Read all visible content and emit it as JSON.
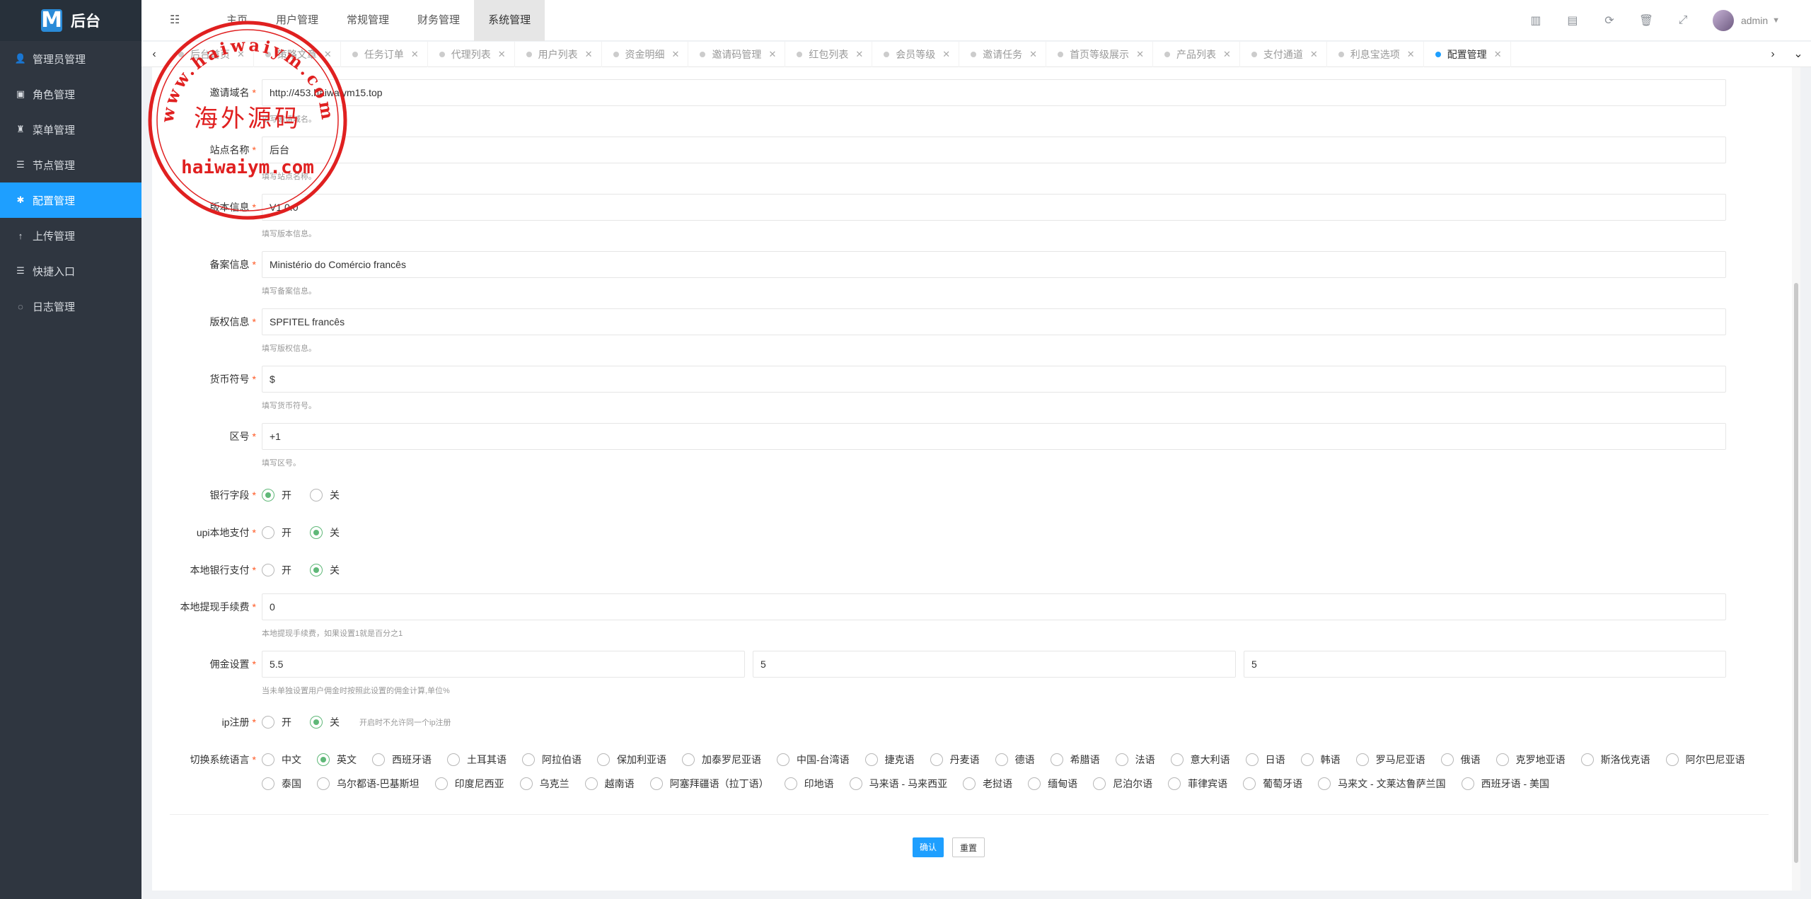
{
  "app": {
    "logo_letter": "M",
    "title": "后台"
  },
  "sidebar": {
    "items": [
      {
        "label": "管理员管理",
        "icon": "user-icon",
        "glyph": "👤"
      },
      {
        "label": "角色管理",
        "icon": "id-card-icon",
        "glyph": "▣"
      },
      {
        "label": "菜单管理",
        "icon": "bell-icon",
        "glyph": "♜"
      },
      {
        "label": "节点管理",
        "icon": "list-icon",
        "glyph": "☰"
      },
      {
        "label": "配置管理",
        "icon": "gear-icon",
        "glyph": "✱"
      },
      {
        "label": "上传管理",
        "icon": "upload-icon",
        "glyph": "↑"
      },
      {
        "label": "快捷入口",
        "icon": "list-icon",
        "glyph": "☰"
      },
      {
        "label": "日志管理",
        "icon": "log-icon",
        "glyph": "◌"
      }
    ],
    "active_index": 4
  },
  "topnav": {
    "items": [
      "主页",
      "用户管理",
      "常规管理",
      "财务管理",
      "系统管理"
    ],
    "active_index": 4
  },
  "topbar_icons": [
    "chart-icon",
    "card-icon",
    "refresh-icon",
    "trash-icon",
    "fullscreen-icon"
  ],
  "user": {
    "name": "admin"
  },
  "tabs": {
    "items": [
      "后台首页",
      "策略文章",
      "任务订单",
      "代理列表",
      "用户列表",
      "资金明细",
      "邀请码管理",
      "红包列表",
      "会员等级",
      "邀请任务",
      "首页等级展示",
      "产品列表",
      "支付通道",
      "利息宝选项",
      "配置管理"
    ],
    "active_index": 14
  },
  "form": {
    "invite_domain": {
      "label": "邀请域名",
      "value": "http://453.haiwaiym15.top",
      "help": "填写邀请域名。"
    },
    "site_name": {
      "label": "站点名称",
      "value": "后台",
      "help": "填写站点名称。"
    },
    "version": {
      "label": "版本信息",
      "value": "V1.0.0",
      "help": "填写版本信息。"
    },
    "record": {
      "label": "备案信息",
      "value": "Ministério do Comércio francês",
      "help": "填写备案信息。"
    },
    "copyright": {
      "label": "版权信息",
      "value": "SPFITEL francês",
      "help": "填写版权信息。"
    },
    "currency": {
      "label": "货币符号",
      "value": "$",
      "help": "填写货币符号。"
    },
    "area_code": {
      "label": "区号",
      "value": "+1",
      "help": "填写区号。"
    },
    "bank_field": {
      "label": "银行字段",
      "on": "开",
      "off": "关",
      "selected": "on"
    },
    "upi_pay": {
      "label": "upi本地支付",
      "on": "开",
      "off": "关",
      "selected": "off"
    },
    "local_bank_pay": {
      "label": "本地银行支付",
      "on": "开",
      "off": "关",
      "selected": "off"
    },
    "withdraw_fee": {
      "label": "本地提现手续费",
      "value": "0",
      "help": "本地提现手续费，如果设置1就是百分之1"
    },
    "commission": {
      "label": "佣金设置",
      "values": [
        "5.5",
        "5",
        "5"
      ],
      "help": "当未单独设置用户佣金时按照此设置的佣金计算,单位%"
    },
    "ip_register": {
      "label": "ip注册",
      "on": "开",
      "off": "关",
      "selected": "off",
      "help": "开启时不允许同一个ip注册"
    },
    "language": {
      "label": "切换系统语言",
      "selected": "英文",
      "options": [
        "中文",
        "英文",
        "西班牙语",
        "土耳其语",
        "阿拉伯语",
        "保加利亚语",
        "加泰罗尼亚语",
        "中国-台湾语",
        "捷克语",
        "丹麦语",
        "德语",
        "希腊语",
        "法语",
        "意大利语",
        "日语",
        "韩语",
        "罗马尼亚语",
        "俄语",
        "克罗地亚语",
        "斯洛伐克语",
        "阿尔巴尼亚语",
        "泰国",
        "乌尔都语-巴基斯坦",
        "印度尼西亚",
        "乌克兰",
        "越南语",
        "阿塞拜疆语（拉丁语）",
        "印地语",
        "马来语 - 马来西亚",
        "老挝语",
        "缅甸语",
        "尼泊尔语",
        "菲律宾语",
        "葡萄牙语",
        "马来文 - 文莱达鲁萨兰国",
        "西班牙语 - 美国"
      ]
    }
  },
  "buttons": {
    "confirm": "确认",
    "reset": "重置"
  },
  "required_mark": "*",
  "stamp": {
    "top_text": "www.haiwaiym.com",
    "center_text": "海外源码",
    "bottom_text": "haiwaiym.com"
  },
  "colors": {
    "sidebar_bg": "#2f3640",
    "accent": "#1e9fff",
    "radio_checked": "#5fb878",
    "stamp_red": "#e02020"
  }
}
